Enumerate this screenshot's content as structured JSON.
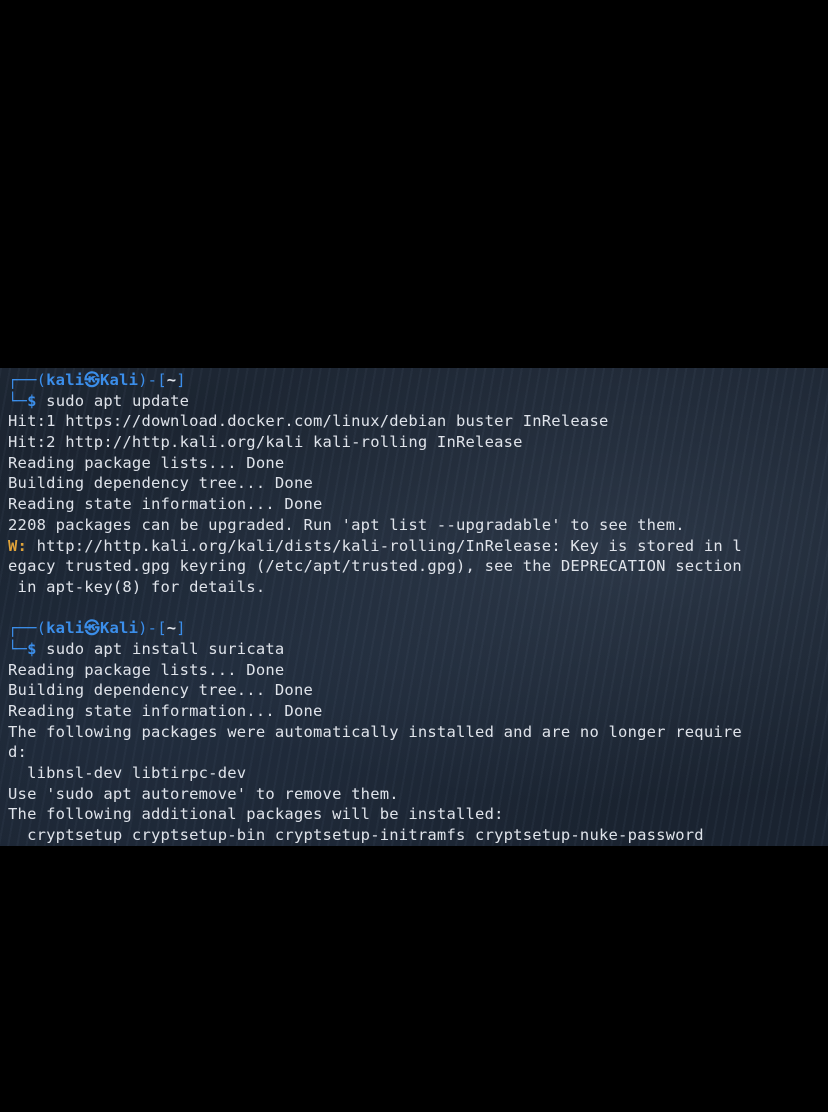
{
  "terminal": {
    "block1": {
      "prompt": {
        "corner": "┌──(",
        "user": "kali",
        "at": "㉿",
        "host": "Kali",
        "mid": ")-[",
        "dir": "~",
        "end": "]"
      },
      "cmd_prefix": "└─",
      "dollar": "$",
      "command": " sudo apt update",
      "output": [
        "Hit:1 https://download.docker.com/linux/debian buster InRelease",
        "Hit:2 http://http.kali.org/kali kali-rolling InRelease",
        "Reading package lists... Done",
        "Building dependency tree... Done",
        "Reading state information... Done",
        "2208 packages can be upgraded. Run 'apt list --upgradable' to see them."
      ],
      "warning_label": "W:",
      "warning_lines": [
        " http://http.kali.org/kali/dists/kali-rolling/InRelease: Key is stored in l",
        "egacy trusted.gpg keyring (/etc/apt/trusted.gpg), see the DEPRECATION section",
        " in apt-key(8) for details."
      ]
    },
    "block2": {
      "prompt": {
        "corner": "┌──(",
        "user": "kali",
        "at": "㉿",
        "host": "Kali",
        "mid": ")-[",
        "dir": "~",
        "end": "]"
      },
      "cmd_prefix": "└─",
      "dollar": "$",
      "command": " sudo apt install suricata",
      "output": [
        "Reading package lists... Done",
        "Building dependency tree... Done",
        "Reading state information... Done",
        "The following packages were automatically installed and are no longer require",
        "d:",
        "  libnsl-dev libtirpc-dev",
        "Use 'sudo apt autoremove' to remove them.",
        "The following additional packages will be installed:",
        "  cryptsetup cryptsetup-bin cryptsetup-initramfs cryptsetup-nuke-password"
      ]
    }
  },
  "colors": {
    "prompt_blue": "#3b8eea",
    "warning_orange": "#e0a33a",
    "text": "#dfe3ea",
    "background": "#1b2430"
  }
}
